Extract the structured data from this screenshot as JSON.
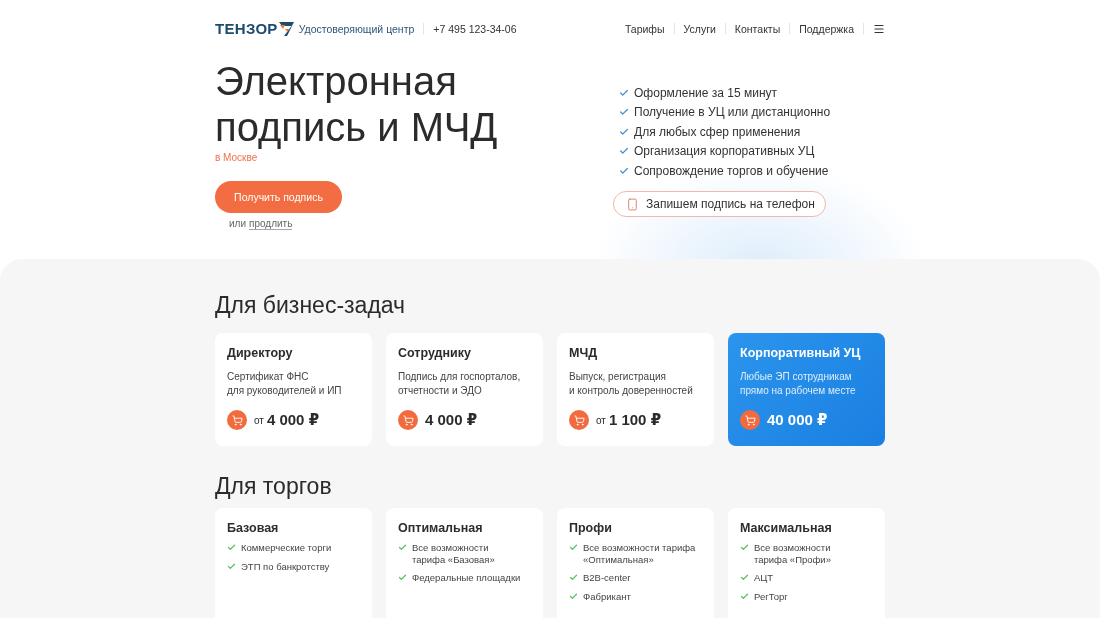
{
  "header": {
    "logo": "ТЕНЗОР",
    "logo_caption": "Удостоверяющий центр",
    "phone": "+7 495 123-34-06",
    "nav": [
      "Тарифы",
      "Услуги",
      "Контакты",
      "Поддержка"
    ]
  },
  "hero": {
    "title": "Электронная подпись и МЧД",
    "city": "в Москве",
    "cta": "Получить подпись",
    "renew_prefix": "или",
    "renew_link": "продлить",
    "features": [
      "Оформление за 15 минут",
      "Получение в УЦ или дистанционно",
      "Для любых сфер применения",
      "Организация корпоративных УЦ",
      "Сопровождение торгов и обучение"
    ],
    "phone_button": "Запишем подпись на телефон"
  },
  "business": {
    "title": "Для бизнес-задач",
    "cards": [
      {
        "title": "Директору",
        "description": "Сертификат ФНС\nдля руководителей и ИП",
        "price_prefix": "от",
        "price": "4 000 ₽",
        "highlighted": false
      },
      {
        "title": "Сотруднику",
        "description": "Подпись для госпорталов,\nотчетности и ЭДО",
        "price": "4 000 ₽",
        "highlighted": false
      },
      {
        "title": "МЧД",
        "description": "Выпуск, регистрация\nи контроль доверенностей",
        "price_prefix": "от",
        "price": "1 100 ₽",
        "highlighted": false
      },
      {
        "title": "Корпоративный УЦ",
        "description": "Любые ЭП сотрудникам\nпрямо на рабочем месте",
        "price": "40 000 ₽",
        "highlighted": true
      }
    ]
  },
  "trading": {
    "title": "Для торгов",
    "cards": [
      {
        "title": "Базовая",
        "features": [
          "Коммерческие торги",
          "ЭТП по банкротству"
        ]
      },
      {
        "title": "Оптимальная",
        "features": [
          "Все возможности\nтарифа «Базовая»",
          "Федеральные площадки"
        ]
      },
      {
        "title": "Профи",
        "features": [
          "Все возможности тарифа\n«Оптимальная»",
          "B2B-center",
          "Фабрикант"
        ]
      },
      {
        "title": "Максимальная",
        "features": [
          "Все возможности\nтарифа «Профи»",
          "АЦТ",
          "РегТорг"
        ]
      }
    ]
  }
}
